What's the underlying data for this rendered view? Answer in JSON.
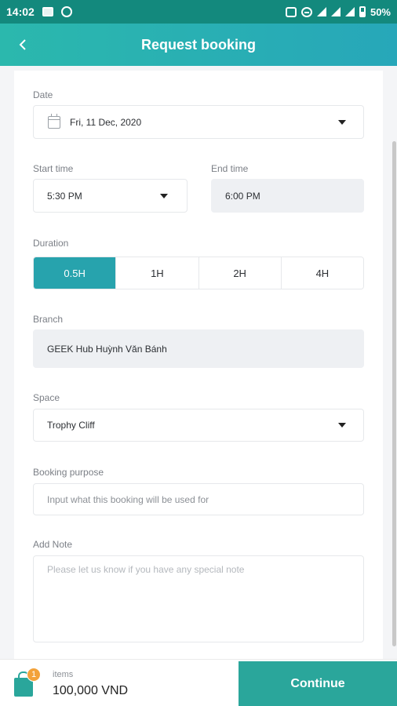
{
  "status_bar": {
    "time": "14:02",
    "battery": "50%"
  },
  "app_bar": {
    "title": "Request booking"
  },
  "form": {
    "date": {
      "label": "Date",
      "value": "Fri, 11 Dec, 2020"
    },
    "start_time": {
      "label": "Start time",
      "value": "5:30 PM"
    },
    "end_time": {
      "label": "End time",
      "value": "6:00 PM"
    },
    "duration": {
      "label": "Duration",
      "options": [
        "0.5H",
        "1H",
        "2H",
        "4H"
      ],
      "selected": "0.5H"
    },
    "branch": {
      "label": "Branch",
      "value": "GEEK Hub Huỳnh Văn Bánh"
    },
    "space": {
      "label": "Space",
      "value": "Trophy Cliff"
    },
    "purpose": {
      "label": "Booking purpose",
      "placeholder": "Input what this booking will be used for"
    },
    "note": {
      "label": "Add Note",
      "placeholder": "Please let us know if you have any special note"
    }
  },
  "bottom_bar": {
    "cart_count": "1",
    "items_label": "items",
    "price": "100,000 VND",
    "continue_label": "Continue"
  },
  "colors": {
    "accent": "#27a3ad",
    "status_bar": "#13897d",
    "button": "#2aa69b",
    "badge": "#f3a23a"
  }
}
